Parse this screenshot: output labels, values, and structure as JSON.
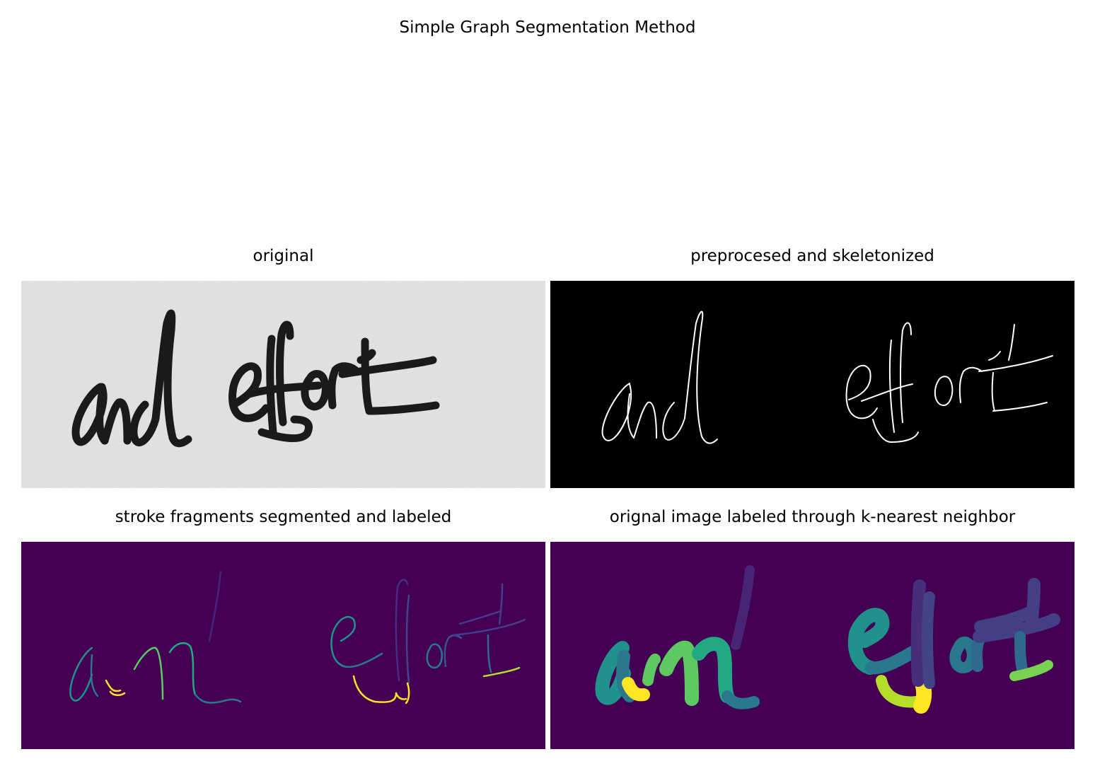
{
  "figure": {
    "title": "Simple Graph Segmentation Method",
    "panels": [
      {
        "title": "original",
        "kind": "original",
        "background": "#e4e4e4"
      },
      {
        "title": "preprocesed and skeletonized",
        "kind": "skeleton",
        "background": "#000000"
      },
      {
        "title": "stroke fragments segmented and labeled",
        "kind": "fragments",
        "background": "#440154"
      },
      {
        "title": "orignal image labeled through k-nearest neighbor",
        "kind": "knn",
        "background": "#440154"
      }
    ],
    "handwritten_text": "and effort",
    "colors": {
      "viridis_dark": "#440154",
      "viridis_indigo": "#3b528b",
      "viridis_teal": "#21918c",
      "viridis_green": "#5ec962",
      "viridis_yellow": "#fde725",
      "ink": "#1a1a1a",
      "skeleton": "#ffffff"
    }
  }
}
